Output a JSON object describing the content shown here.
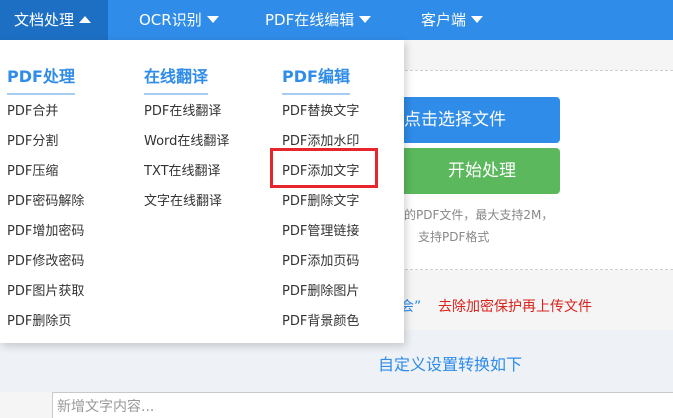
{
  "nav": {
    "items": [
      {
        "label": "文档处理",
        "active": true
      },
      {
        "label": "OCR识别",
        "active": false
      },
      {
        "label": "PDF在线编辑",
        "active": false
      },
      {
        "label": "客户端",
        "active": false
      }
    ]
  },
  "dropdown": {
    "columns": [
      {
        "header": "PDF处理",
        "items": [
          "PDF合并",
          "PDF分割",
          "PDF压缩",
          "PDF密码解除",
          "PDF增加密码",
          "PDF修改密码",
          "PDF图片获取",
          "PDF删除页"
        ]
      },
      {
        "header": "在线翻译",
        "items": [
          "PDF在线翻译",
          "Word在线翻译",
          "TXT在线翻译",
          "文字在线翻译"
        ]
      },
      {
        "header": "PDF编辑",
        "items": [
          "PDF替换文字",
          "PDF添加水印",
          "PDF添加文字",
          "PDF删除文字",
          "PDF管理链接",
          "PDF添加页码",
          "PDF删除图片",
          "PDF背景颜色"
        ]
      }
    ],
    "highlighted_item": "PDF添加文字"
  },
  "upload": {
    "select_button": "点击选择文件",
    "start_button": "开始处理",
    "hint_line1": "理的PDF文件，最大支持2M，",
    "hint_line2": "支持PDF格式"
  },
  "notice": {
    "quote_fragment": "会”",
    "warning": "去除加密保护再上传文件"
  },
  "settings": {
    "title": "自定义设置转换如下",
    "text_placeholder": "新增文字内容..."
  },
  "colors": {
    "nav_bg": "#2f8ce8",
    "nav_active": "#1d6fc4",
    "accent_blue": "#2f8ce8",
    "start_green": "#5cb85c",
    "highlight_red": "#e5262c",
    "warning_red": "#d9221c"
  }
}
